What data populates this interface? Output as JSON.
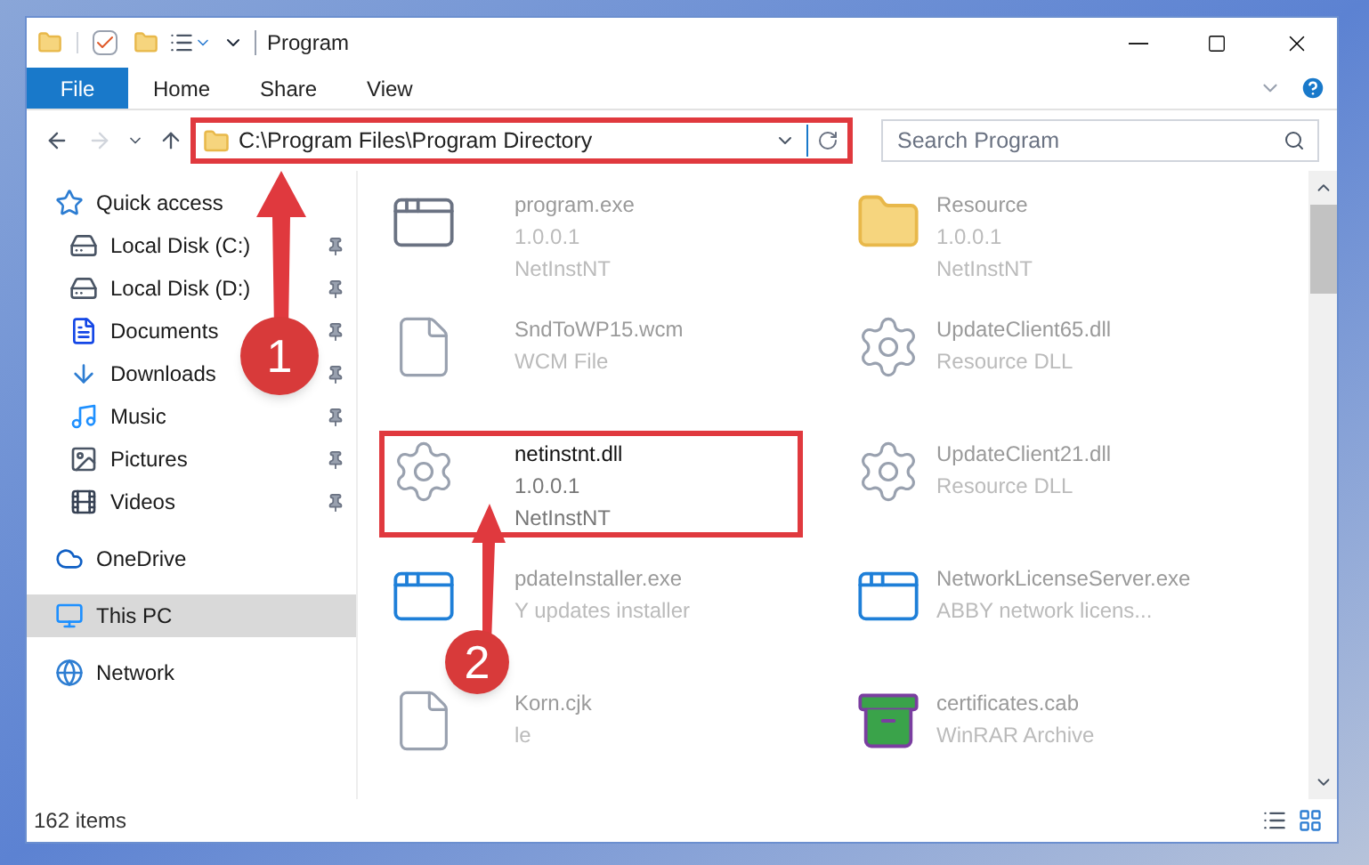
{
  "window": {
    "title": "Program"
  },
  "ribbon": {
    "file_tab": "File",
    "tabs": [
      "Home",
      "Share",
      "View"
    ]
  },
  "address_bar": {
    "path": "C:\\Program Files\\Program Directory",
    "highlighted": true
  },
  "search": {
    "placeholder": "Search Program"
  },
  "sidebar": {
    "items": [
      {
        "label": "Quick access",
        "selected": false,
        "children": [
          {
            "label": "Local Disk (C:)",
            "pinned": true
          },
          {
            "label": "Local Disk (D:)",
            "pinned": true
          },
          {
            "label": "Documents",
            "pinned": true
          },
          {
            "label": "Downloads",
            "pinned": true
          },
          {
            "label": "Music",
            "pinned": true
          },
          {
            "label": "Pictures",
            "pinned": true
          },
          {
            "label": "Videos",
            "pinned": true
          }
        ]
      },
      {
        "label": "OneDrive",
        "selected": false
      },
      {
        "label": "This PC",
        "selected": true
      },
      {
        "label": "Network",
        "selected": false
      }
    ]
  },
  "files": [
    {
      "kind": "exe",
      "name": "program.exe",
      "details": [
        "1.0.0.1",
        "NetInstNT"
      ],
      "highlighted": false
    },
    {
      "kind": "folder",
      "name": "Resource",
      "details": [
        "1.0.0.1",
        "NetInstNT"
      ],
      "highlighted": false
    },
    {
      "kind": "blank",
      "name": "SndToWP15.wcm",
      "details": [
        "WCM File"
      ],
      "highlighted": false
    },
    {
      "kind": "dll",
      "name": "UpdateClient65.dll",
      "details": [
        "Resource DLL"
      ],
      "highlighted": false
    },
    {
      "kind": "dll",
      "name": "netinstnt.dll",
      "details": [
        "1.0.0.1",
        "NetInstNT"
      ],
      "highlighted": true
    },
    {
      "kind": "dll",
      "name": "UpdateClient21.dll",
      "details": [
        "Resource DLL"
      ],
      "highlighted": false
    },
    {
      "kind": "app",
      "name": "pdateInstaller.exe",
      "details": [
        "Y updates installer"
      ],
      "highlighted": false
    },
    {
      "kind": "app",
      "name": "NetworkLicenseServer.exe",
      "details": [
        "ABBY network licens..."
      ],
      "highlighted": false
    },
    {
      "kind": "blank",
      "name": "Korn.cjk",
      "details": [
        "le"
      ],
      "highlighted": false
    },
    {
      "kind": "archive",
      "name": "certificates.cab",
      "details": [
        "WinRAR Archive"
      ],
      "highlighted": false
    }
  ],
  "annotations": [
    {
      "label": "1"
    },
    {
      "label": "2"
    }
  ],
  "status_bar": {
    "item_count": "162 items"
  }
}
